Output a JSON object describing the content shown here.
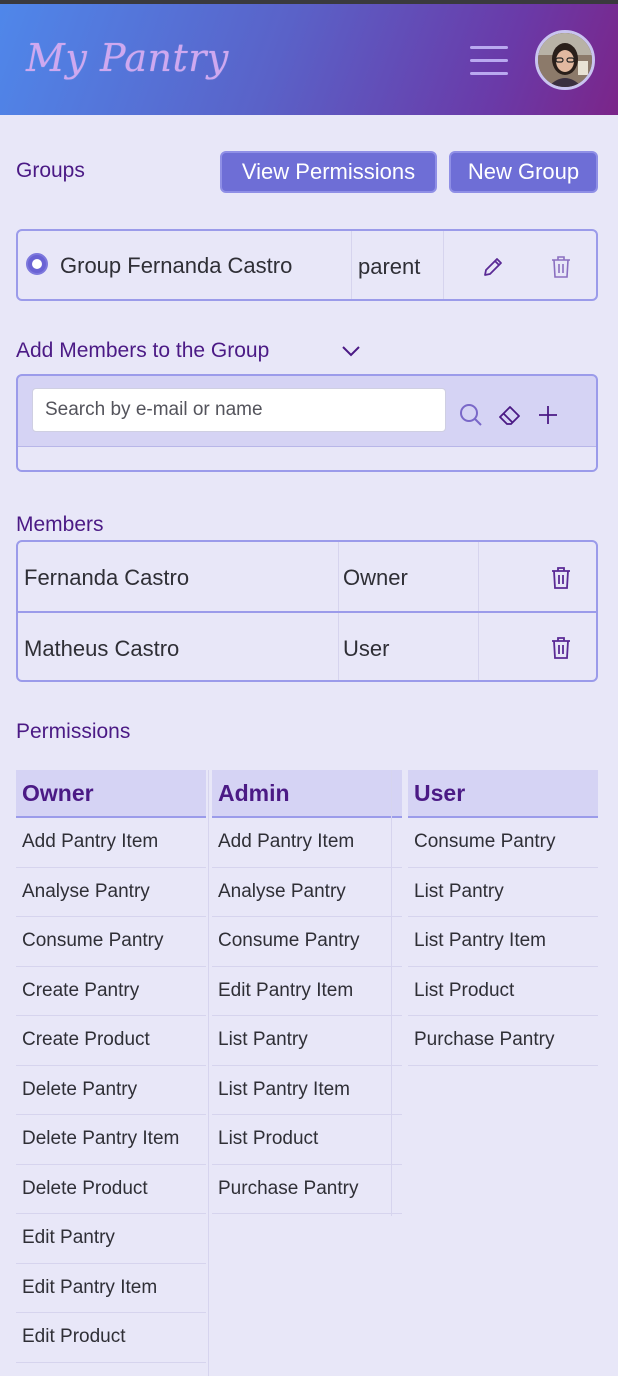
{
  "app": {
    "title": "My Pantry"
  },
  "groups": {
    "title": "Groups",
    "view_permissions_label": "View Permissions",
    "new_group_label": "New Group",
    "items": [
      {
        "name": "Group Fernanda Castro",
        "role": "parent",
        "selected": true
      }
    ]
  },
  "add_members": {
    "title": "Add Members to the Group",
    "search_placeholder": "Search by e-mail or name",
    "search_value": ""
  },
  "members": {
    "title": "Members",
    "rows": [
      {
        "name": "Fernanda Castro",
        "role": "Owner"
      },
      {
        "name": "Matheus Castro",
        "role": "User"
      }
    ]
  },
  "permissions": {
    "title": "Permissions",
    "columns": [
      {
        "header": "Owner",
        "items": [
          "Add Pantry Item",
          "Analyse Pantry",
          "Consume Pantry",
          "Create Pantry",
          "Create Product",
          "Delete Pantry",
          "Delete Pantry Item",
          "Delete Product",
          "Edit Pantry",
          "Edit Pantry Item",
          "Edit Product"
        ]
      },
      {
        "header": "Admin",
        "items": [
          "Add Pantry Item",
          "Analyse Pantry",
          "Consume Pantry",
          "Edit Pantry Item",
          "List Pantry",
          "List Pantry Item",
          "List Product",
          "Purchase Pantry"
        ]
      },
      {
        "header": "User",
        "items": [
          "Consume Pantry",
          "List Pantry",
          "List Pantry Item",
          "List Product",
          "Purchase Pantry"
        ]
      }
    ]
  },
  "colors": {
    "accent": "#6e6ed6",
    "heading": "#4b1a85",
    "background": "#e8e7f8",
    "border": "#9b9bea"
  },
  "icons": [
    "menu-icon",
    "avatar",
    "radio-icon",
    "pencil-icon",
    "trash-icon",
    "chevron-down-icon",
    "search-icon",
    "eraser-icon",
    "plus-icon"
  ]
}
